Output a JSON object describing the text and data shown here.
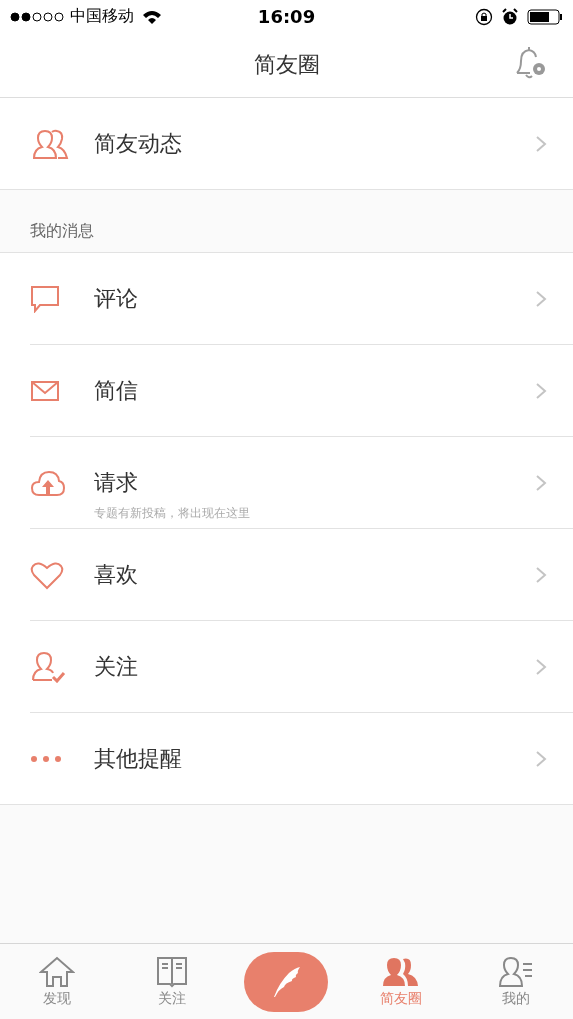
{
  "status_bar": {
    "carrier": "中国移动",
    "time": "16:09"
  },
  "nav": {
    "title": "简友圈"
  },
  "top_item": {
    "label": "简友动态",
    "kind": "friends"
  },
  "section": {
    "title": "我的消息"
  },
  "items": [
    {
      "label": "评论",
      "kind": "comment"
    },
    {
      "label": "简信",
      "kind": "mail"
    },
    {
      "label": "请求",
      "kind": "upload",
      "subtitle": "专题有新投稿，将出现在这里"
    },
    {
      "label": "喜欢",
      "kind": "heart"
    },
    {
      "label": "关注",
      "kind": "follow"
    },
    {
      "label": "其他提醒",
      "kind": "dots"
    }
  ],
  "tabs": [
    {
      "label": "发现",
      "kind": "home",
      "selected": false
    },
    {
      "label": "关注",
      "kind": "book",
      "selected": false
    },
    {
      "kind": "compose",
      "selected": false
    },
    {
      "label": "简友圈",
      "kind": "friends",
      "selected": true
    },
    {
      "label": "我的",
      "kind": "profile",
      "selected": false
    }
  ]
}
